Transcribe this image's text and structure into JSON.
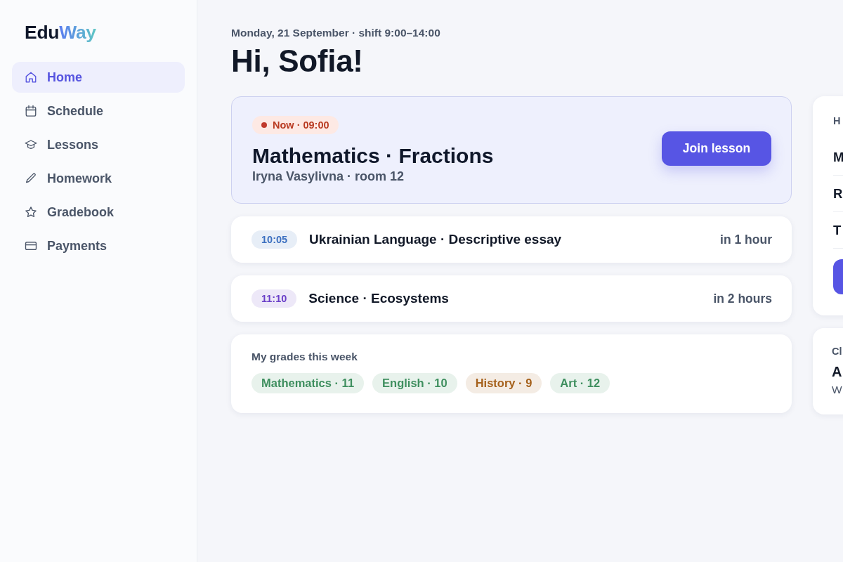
{
  "sidebar": {
    "logo": {
      "prefix": "Edu",
      "suffix": "Way"
    },
    "items": [
      {
        "label": "Home",
        "selected": true
      },
      {
        "label": "Schedule",
        "selected": false
      },
      {
        "label": "Lessons",
        "selected": false
      },
      {
        "label": "Homework",
        "selected": false
      },
      {
        "label": "Gradebook",
        "selected": false
      },
      {
        "label": "Payments",
        "selected": false
      }
    ]
  },
  "header": {
    "date_line": "Monday, 21 September · shift 9:00–14:00",
    "greeting": "Hi, Sofia!"
  },
  "current_lesson": {
    "badge": "Now · 09:00",
    "title": "Mathematics · Fractions",
    "subtitle": "Iryna Vasylivna · room 12",
    "button": "Join lesson"
  },
  "upcoming_lessons": [
    {
      "time": "10:05",
      "color": "#3b6fc0",
      "title": "Ukrainian Language · Descriptive essay",
      "starts_in": "in 1 hour"
    },
    {
      "time": "11:10",
      "color": "#6a3fc8",
      "title": "Science · Ecosystems",
      "starts_in": "in 2 hours"
    }
  ],
  "grades": {
    "title": "My grades this week",
    "items": [
      {
        "label": "Mathematics · 11",
        "color": "#3f8f5f"
      },
      {
        "label": "English · 10",
        "color": "#3f8f5f"
      },
      {
        "label": "History · 9",
        "color": "#a5611c"
      },
      {
        "label": "Art · 12",
        "color": "#3f8f5f"
      }
    ]
  },
  "right_panel": {
    "card_1": {
      "heading": "H",
      "items": [
        "M",
        "R",
        "T"
      ]
    },
    "card_2": {
      "label": "Cl",
      "title": "A",
      "text": "W"
    }
  }
}
